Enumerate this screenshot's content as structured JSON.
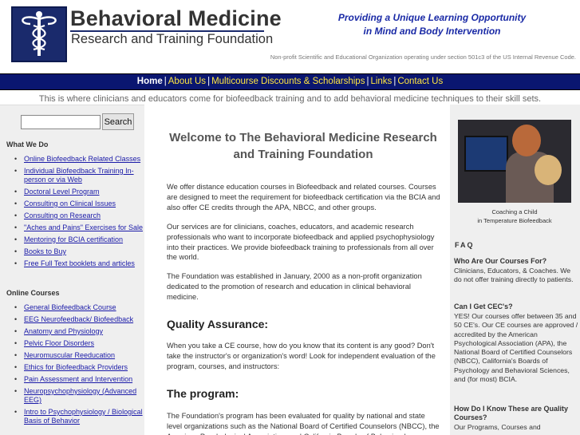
{
  "header": {
    "logo_title": "Behavioral Medicine",
    "logo_subtitle": "Research and Training Foundation",
    "tagline_line1": "Providing a Unique Learning Opportunity",
    "tagline_line2": "in Mind and Body Intervention",
    "nonprofit": "Non-profit Scientific and Educational Organization operating under section 501c3 of the US Internal Revenue Code."
  },
  "nav": {
    "items": [
      {
        "label": "Home",
        "active": true
      },
      {
        "label": "About Us"
      },
      {
        "label": "Multicourse Discounts & Scholarships"
      },
      {
        "label": "Links"
      },
      {
        "label": "Contact Us"
      }
    ],
    "separator": "|"
  },
  "intro": "This is where clinicians and educators come for biofeedback training and to add behavioral medicine techniques to their skill sets.",
  "search": {
    "placeholder": "",
    "button": "Search"
  },
  "sidebar": {
    "what_we_do_title": "What We Do",
    "what_we_do": [
      "Online Biofeedback Related Classes",
      "Individual Biofeedback Training In-person or via Web",
      "Doctoral Level Program",
      "Consulting on Clinical Issues",
      "Consulting on Research",
      "\"Aches and Pains\" Exercises for Sale",
      "Mentoring for BCIA certification",
      "Books to Buy",
      "Free Full Text booklets and articles"
    ],
    "online_courses_title": "Online Courses",
    "online_courses": [
      "General Biofeedback Course",
      "EEG Neurofeedback/ Biofeedback",
      "Anatomy and Physiology",
      "Pelvic Floor Disorders",
      "Neuromuscular Reeducation",
      "Ethics for Biofeedback Providers",
      "Pain Assessment and Intervention",
      "Neuropsychophysiology (Advanced EEG)",
      "Intro to Psychophysiology / Biological Basis of Behavior"
    ]
  },
  "main": {
    "title": "Welcome to The Behavioral Medicine Research and Training Foundation",
    "p1": "We offer distance education courses in Biofeedback and related courses. Courses are designed to meet the requirement for biofeedback certification via the BCIA and also offer CE credits through the APA, NBCC, and other groups.",
    "p2": "Our services are for clinicians, coaches, educators, and academic research professionals who want to incorporate biofeedback and applied psychophysiology into their practices. We provide biofeedback training to professionals from all over the world.",
    "p3": "The Foundation was established in January, 2000 as a non-profit organization dedicated to the promotion of research and education in clinical behavioral medicine.",
    "h_quality": "Quality Assurance:",
    "p4": "When you take a CE course, how do you know that its content is any good? Don't take the instructor's or organization's word! Look for independent evaluation of the program, courses, and instructors:",
    "h_program": "The program:",
    "p5": "The Foundation's program has been evaluated for quality by national and state level organizations such as the National Board of Certified Counselors (NBCC), the American Psychological Association, and California Boards of Behavioral"
  },
  "right": {
    "caption_line1": "Coaching a Child",
    "caption_line2": "in Temperature Biofeedback",
    "faq_title": "FAQ",
    "q1": "Who Are Our Courses For?",
    "a1": "Clinicians, Educators, & Coaches. We do not offer training directly to patients.",
    "q2": "Can I Get CEC's?",
    "a2": "YES! Our courses offer between 35 and 50 CE's. Our CE courses are approved / accredited by the American Psychological Association (APA), the National Board of Certified Counselors (NBCC), California's Boards of Psychology and Behavioral Sciences, and (for most) BCIA.",
    "q3": "How Do I Know These are Quality Courses?",
    "a3": "Our Programs, Courses and"
  },
  "colors": {
    "nav_bg": "#0a1670",
    "nav_link": "#ffe640",
    "tagline": "#1a2aa6",
    "link": "#1a1aa8"
  }
}
